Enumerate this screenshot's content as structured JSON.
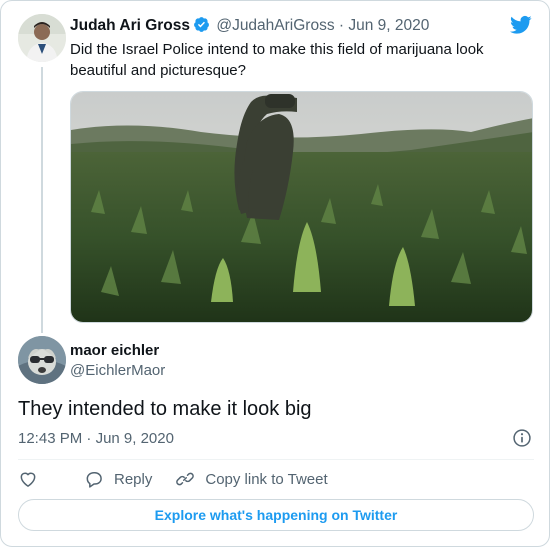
{
  "parent_tweet": {
    "author_name": "Judah Ari Gross",
    "author_handle": "@JudahAriGross",
    "separator": "·",
    "date": "Jun 9, 2020",
    "text": "Did the Israel Police intend to make this field of marijuana look beautiful and picturesque?",
    "verified": true
  },
  "reply_tweet": {
    "author_name": "maor eichler",
    "author_handle": "@EichlerMaor",
    "text": "They intended to make it look big",
    "time": "12:43 PM",
    "separator": "·",
    "date": "Jun 9, 2020"
  },
  "actions": {
    "reply_label": "Reply",
    "copy_link_label": "Copy link to Tweet"
  },
  "footer": {
    "explore_label": "Explore what's happening on Twitter"
  },
  "colors": {
    "accent": "#1d9bf0",
    "text": "#0f1419",
    "muted": "#536471",
    "border": "#cfd9de"
  },
  "icons": {
    "brand": "twitter-bird-icon",
    "verified": "verified-badge-icon",
    "info": "info-icon",
    "like": "heart-icon",
    "reply": "reply-bubble-icon",
    "copy_link": "link-icon"
  }
}
